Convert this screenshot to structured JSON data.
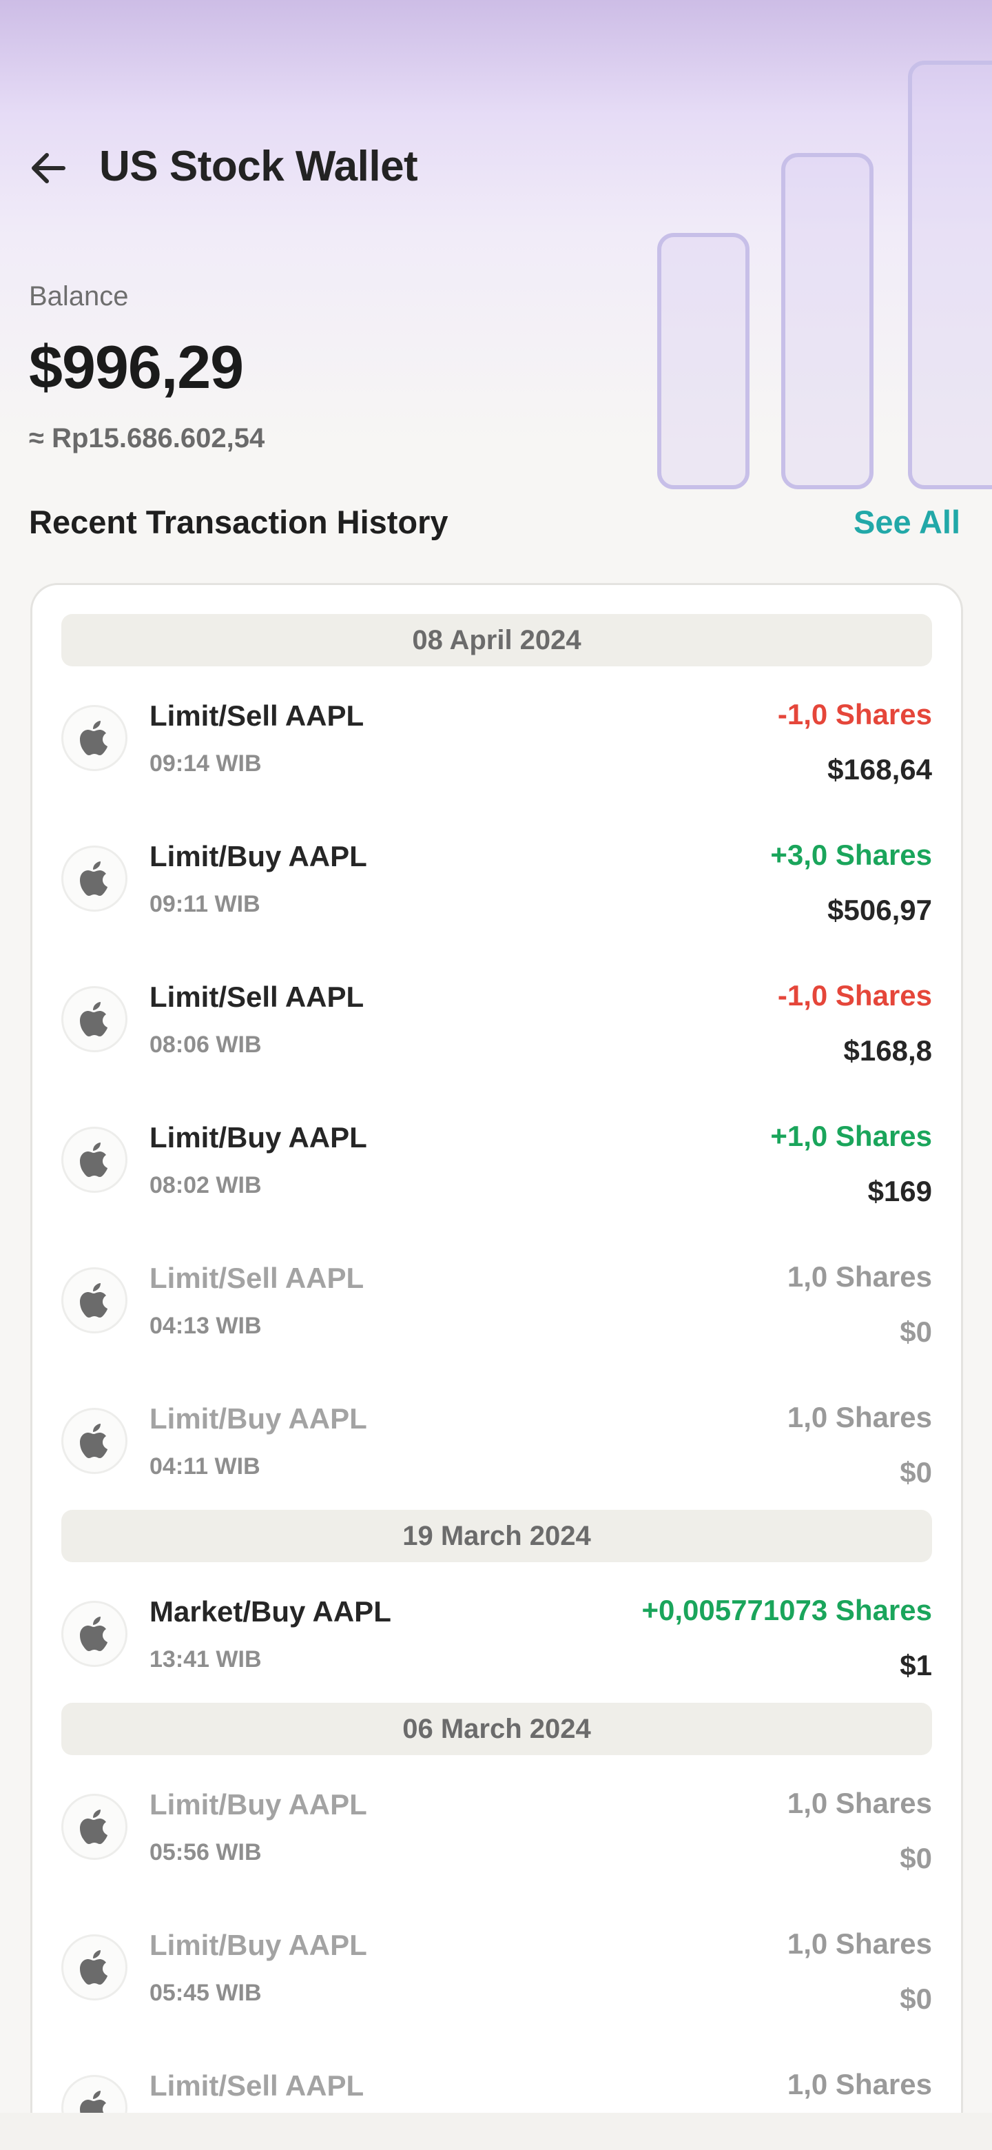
{
  "header": {
    "title": "US Stock Wallet",
    "back_icon": "arrow-left-icon"
  },
  "balance": {
    "label": "Balance",
    "value": "$996,29",
    "idr": "≈ Rp15.686.602,54"
  },
  "history": {
    "title": "Recent Transaction History",
    "see_all": "See All"
  },
  "colors": {
    "negative": "#e5463a",
    "positive": "#1aa55b",
    "muted": "#9a9a9a",
    "accent": "#22a8a8"
  },
  "groups": [
    {
      "date": "08 April 2024",
      "items": [
        {
          "name": "Limit/Sell AAPL",
          "time": "09:14 WIB",
          "shares": "-1,0 Shares",
          "amount": "$168,64",
          "status": "negative"
        },
        {
          "name": "Limit/Buy AAPL",
          "time": "09:11 WIB",
          "shares": "+3,0 Shares",
          "amount": "$506,97",
          "status": "positive"
        },
        {
          "name": "Limit/Sell AAPL",
          "time": "08:06 WIB",
          "shares": "-1,0 Shares",
          "amount": "$168,8",
          "status": "negative"
        },
        {
          "name": "Limit/Buy AAPL",
          "time": "08:02 WIB",
          "shares": "+1,0 Shares",
          "amount": "$169",
          "status": "positive"
        },
        {
          "name": "Limit/Sell AAPL",
          "time": "04:13 WIB",
          "shares": "1,0 Shares",
          "amount": "$0",
          "status": "muted"
        },
        {
          "name": "Limit/Buy AAPL",
          "time": "04:11 WIB",
          "shares": "1,0 Shares",
          "amount": "$0",
          "status": "muted"
        }
      ]
    },
    {
      "date": "19 March 2024",
      "items": [
        {
          "name": "Market/Buy AAPL",
          "time": "13:41 WIB",
          "shares": "+0,005771073 Shares",
          "amount": "$1",
          "status": "positive"
        }
      ]
    },
    {
      "date": "06 March 2024",
      "items": [
        {
          "name": "Limit/Buy AAPL",
          "time": "05:56 WIB",
          "shares": "1,0 Shares",
          "amount": "$0",
          "status": "muted"
        },
        {
          "name": "Limit/Buy AAPL",
          "time": "05:45 WIB",
          "shares": "1,0 Shares",
          "amount": "$0",
          "status": "muted"
        },
        {
          "name": "Limit/Sell AAPL",
          "time": "",
          "shares": "1,0 Shares",
          "amount": "",
          "status": "muted"
        }
      ]
    }
  ]
}
